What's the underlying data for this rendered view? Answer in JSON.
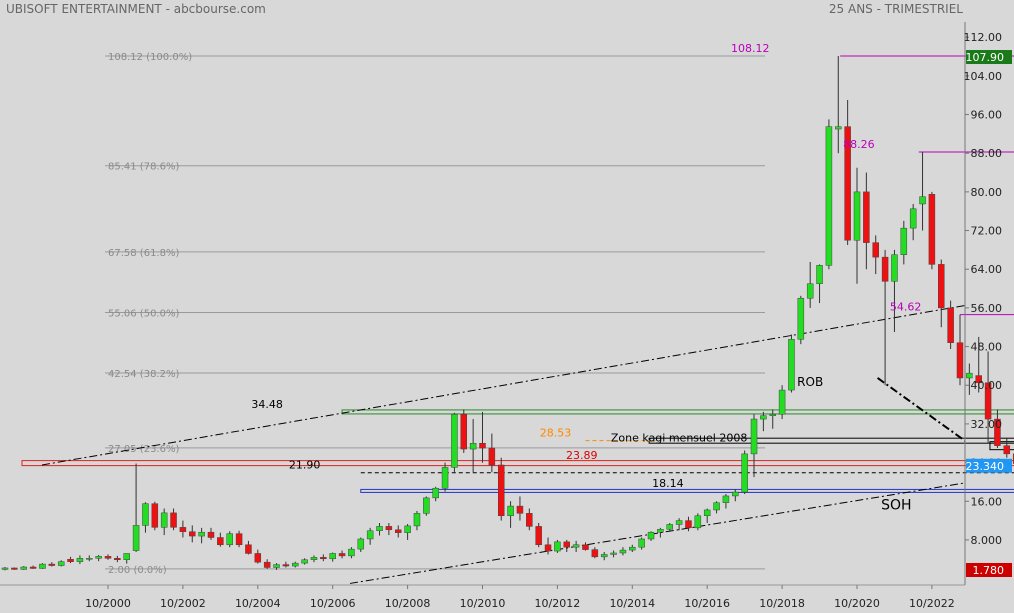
{
  "header": {
    "left_title": "UBISOFT ENTERTAINMENT - abcbourse.com",
    "right_title": "25 ANS - TRIMESTRIEL"
  },
  "colors": {
    "background": "#d8d8d8",
    "up": "#22dd22",
    "down": "#ee1111",
    "price_badge": "#2196f3",
    "last_price_badge": "#cc0000",
    "high_badge": "#1a7a1a",
    "magenta": "#bb00bb",
    "fib_text": "#8a8a8a"
  },
  "chart_data": {
    "type": "candlestick",
    "title": "UBISOFT ENTERTAINMENT - abcbourse.com",
    "subtitle": "25 ANS - TRIMESTRIEL",
    "ylim": [
      0,
      116
    ],
    "y_ticks": [
      "112.00",
      "104.00",
      "96.00",
      "88.00",
      "80.00",
      "72.00",
      "64.00",
      "56.00",
      "48.00",
      "40.00",
      "32.00",
      "24.00",
      "16.00",
      "8.000"
    ],
    "y_tick_values": [
      112,
      104,
      96,
      88,
      80,
      72,
      64,
      56,
      48,
      40,
      32,
      24,
      16,
      8
    ],
    "x_ticks": [
      "10/2000",
      "10/2002",
      "10/2004",
      "10/2006",
      "10/2008",
      "10/2010",
      "10/2012",
      "10/2014",
      "10/2016",
      "10/2018",
      "10/2020",
      "10/2022"
    ],
    "x_tick_years": [
      2000.75,
      2002.75,
      2004.75,
      2006.75,
      2008.75,
      2010.75,
      2012.75,
      2014.75,
      2016.75,
      2018.75,
      2020.75,
      2022.75
    ],
    "price_badges": [
      {
        "label": "107.90",
        "value": 107.9,
        "role": "high"
      },
      {
        "label": "23.340",
        "value": 23.34,
        "role": "current"
      },
      {
        "label": "1.780",
        "value": 1.78,
        "role": "low"
      }
    ],
    "fib_levels": [
      {
        "label": "108.12  (100.0%)",
        "value": 108.12
      },
      {
        "label": "85.41  (78.6%)",
        "value": 85.41
      },
      {
        "label": "67.58  (61.8%)",
        "value": 67.58
      },
      {
        "label": "55.06  (50.0%)",
        "value": 55.06
      },
      {
        "label": "42.54  (38.2%)",
        "value": 42.54
      },
      {
        "label": "27.05  (23.6%)",
        "value": 27.05
      },
      {
        "label": "2.00  (0.0%)",
        "value": 2.0
      }
    ],
    "annotations": [
      {
        "label": "108.12",
        "x": 2017.9,
        "y": 108.12,
        "color": "#bb00bb"
      },
      {
        "label": "88.26",
        "x": 2020.8,
        "y": 88.26,
        "color": "#bb00bb"
      },
      {
        "label": "54.62",
        "x": 2022.05,
        "y": 54.62,
        "color": "#bb00bb"
      },
      {
        "label": "34.48",
        "x": 2005.0,
        "y": 34.48,
        "color": "#000000"
      },
      {
        "label": "28.53",
        "x": 2012.7,
        "y": 28.53,
        "color": "#ff8800"
      },
      {
        "label": "23.89",
        "x": 2013.4,
        "y": 23.89,
        "color": "#dd0000"
      },
      {
        "label": "21.90",
        "x": 2006.0,
        "y": 21.9,
        "color": "#000000"
      },
      {
        "label": "18.14",
        "x": 2015.7,
        "y": 18.14,
        "color": "#000000"
      },
      {
        "label": "Zone kagi mensuel 2008",
        "x": 2016.0,
        "y": 27.5,
        "color": "#000000"
      },
      {
        "label": "ROB",
        "x": 2019.5,
        "y": 39.0,
        "color": "#000000"
      },
      {
        "label": "SOH",
        "x": 2021.8,
        "y": 13.5,
        "color": "#000000"
      }
    ],
    "candles": [
      {
        "x": 1997.75,
        "o": 1.8,
        "h": 2.0,
        "l": 1.4,
        "c": 1.9
      },
      {
        "x": 1998.0,
        "o": 1.9,
        "h": 2.4,
        "l": 1.7,
        "c": 2.2
      },
      {
        "x": 1998.25,
        "o": 2.2,
        "h": 2.3,
        "l": 1.8,
        "c": 1.9
      },
      {
        "x": 1998.5,
        "o": 1.9,
        "h": 2.6,
        "l": 1.8,
        "c": 2.4
      },
      {
        "x": 1998.75,
        "o": 2.4,
        "h": 2.7,
        "l": 2.0,
        "c": 2.1
      },
      {
        "x": 1999.0,
        "o": 2.1,
        "h": 3.2,
        "l": 2.0,
        "c": 3.0
      },
      {
        "x": 1999.25,
        "o": 3.0,
        "h": 3.4,
        "l": 2.5,
        "c": 2.7
      },
      {
        "x": 1999.5,
        "o": 2.7,
        "h": 3.8,
        "l": 2.5,
        "c": 3.5
      },
      {
        "x": 1999.75,
        "o": 4.0,
        "h": 4.5,
        "l": 3.2,
        "c": 3.5
      },
      {
        "x": 2000.0,
        "o": 3.5,
        "h": 4.8,
        "l": 3.0,
        "c": 4.2
      },
      {
        "x": 2000.25,
        "o": 4.2,
        "h": 4.8,
        "l": 3.6,
        "c": 4.2
      },
      {
        "x": 2000.5,
        "o": 4.2,
        "h": 4.9,
        "l": 3.6,
        "c": 4.6
      },
      {
        "x": 2000.75,
        "o": 4.6,
        "h": 5.0,
        "l": 3.9,
        "c": 4.2
      },
      {
        "x": 2001.0,
        "o": 4.2,
        "h": 4.7,
        "l": 3.4,
        "c": 3.9
      },
      {
        "x": 2001.25,
        "o": 3.9,
        "h": 5.2,
        "l": 3.1,
        "c": 5.2
      },
      {
        "x": 2001.5,
        "o": 5.8,
        "h": 23.8,
        "l": 5.5,
        "c": 11.0
      },
      {
        "x": 2001.75,
        "o": 11.0,
        "h": 15.8,
        "l": 9.5,
        "c": 15.5
      },
      {
        "x": 2002.0,
        "o": 15.5,
        "h": 15.9,
        "l": 10.0,
        "c": 10.6
      },
      {
        "x": 2002.25,
        "o": 10.6,
        "h": 14.5,
        "l": 9.0,
        "c": 13.6
      },
      {
        "x": 2002.5,
        "o": 13.6,
        "h": 14.5,
        "l": 10.0,
        "c": 10.6
      },
      {
        "x": 2002.75,
        "o": 10.6,
        "h": 12.0,
        "l": 8.5,
        "c": 9.7
      },
      {
        "x": 2003.0,
        "o": 9.7,
        "h": 11.0,
        "l": 7.5,
        "c": 8.8
      },
      {
        "x": 2003.25,
        "o": 8.8,
        "h": 10.5,
        "l": 7.3,
        "c": 9.6
      },
      {
        "x": 2003.5,
        "o": 9.6,
        "h": 10.5,
        "l": 8.0,
        "c": 8.5
      },
      {
        "x": 2003.75,
        "o": 8.5,
        "h": 9.5,
        "l": 6.6,
        "c": 7.0
      },
      {
        "x": 2004.0,
        "o": 7.0,
        "h": 9.8,
        "l": 6.5,
        "c": 9.3
      },
      {
        "x": 2004.25,
        "o": 9.3,
        "h": 9.9,
        "l": 6.5,
        "c": 7.0
      },
      {
        "x": 2004.5,
        "o": 7.0,
        "h": 7.8,
        "l": 5.0,
        "c": 5.2
      },
      {
        "x": 2004.75,
        "o": 5.2,
        "h": 6.0,
        "l": 3.1,
        "c": 3.4
      },
      {
        "x": 2005.0,
        "o": 3.4,
        "h": 4.0,
        "l": 2.0,
        "c": 2.3
      },
      {
        "x": 2005.25,
        "o": 2.3,
        "h": 3.2,
        "l": 1.8,
        "c": 2.9
      },
      {
        "x": 2005.5,
        "o": 2.9,
        "h": 3.5,
        "l": 2.3,
        "c": 2.6
      },
      {
        "x": 2005.75,
        "o": 2.6,
        "h": 3.5,
        "l": 2.3,
        "c": 3.2
      },
      {
        "x": 2006.0,
        "o": 3.2,
        "h": 4.2,
        "l": 2.9,
        "c": 3.9
      },
      {
        "x": 2006.25,
        "o": 3.9,
        "h": 4.8,
        "l": 3.4,
        "c": 4.4
      },
      {
        "x": 2006.5,
        "o": 4.4,
        "h": 5.0,
        "l": 3.6,
        "c": 4.1
      },
      {
        "x": 2006.75,
        "o": 4.1,
        "h": 5.4,
        "l": 3.5,
        "c": 5.2
      },
      {
        "x": 2007.0,
        "o": 5.2,
        "h": 5.8,
        "l": 4.2,
        "c": 4.7
      },
      {
        "x": 2007.25,
        "o": 4.7,
        "h": 6.5,
        "l": 4.2,
        "c": 6.1
      },
      {
        "x": 2007.5,
        "o": 6.1,
        "h": 8.5,
        "l": 5.5,
        "c": 8.2
      },
      {
        "x": 2007.75,
        "o": 8.2,
        "h": 10.5,
        "l": 7.0,
        "c": 9.9
      },
      {
        "x": 2008.0,
        "o": 9.9,
        "h": 11.5,
        "l": 8.9,
        "c": 10.8
      },
      {
        "x": 2008.25,
        "o": 10.8,
        "h": 11.5,
        "l": 9.0,
        "c": 10.1
      },
      {
        "x": 2008.5,
        "o": 10.1,
        "h": 11.0,
        "l": 8.5,
        "c": 9.5
      },
      {
        "x": 2008.75,
        "o": 9.5,
        "h": 11.3,
        "l": 8.0,
        "c": 10.9
      },
      {
        "x": 2009.0,
        "o": 10.9,
        "h": 14.0,
        "l": 10.0,
        "c": 13.5
      },
      {
        "x": 2009.25,
        "o": 13.5,
        "h": 17.0,
        "l": 13.0,
        "c": 16.7
      },
      {
        "x": 2009.5,
        "o": 16.7,
        "h": 19.0,
        "l": 16.0,
        "c": 18.7
      },
      {
        "x": 2009.75,
        "o": 18.7,
        "h": 24.0,
        "l": 18.0,
        "c": 23.0
      },
      {
        "x": 2010.0,
        "o": 23.0,
        "h": 34.3,
        "l": 22.0,
        "c": 34.0
      },
      {
        "x": 2010.25,
        "o": 34.0,
        "h": 35.0,
        "l": 26.0,
        "c": 26.8
      },
      {
        "x": 2010.5,
        "o": 26.8,
        "h": 33.0,
        "l": 22.0,
        "c": 28.0
      },
      {
        "x": 2010.75,
        "o": 28.0,
        "h": 34.5,
        "l": 24.0,
        "c": 27.0
      },
      {
        "x": 2011.0,
        "o": 27.0,
        "h": 30.0,
        "l": 22.0,
        "c": 23.5
      },
      {
        "x": 2011.25,
        "o": 23.5,
        "h": 25.0,
        "l": 12.0,
        "c": 13.0
      },
      {
        "x": 2011.5,
        "o": 13.0,
        "h": 16.0,
        "l": 10.5,
        "c": 15.0
      },
      {
        "x": 2011.75,
        "o": 15.0,
        "h": 17.0,
        "l": 12.0,
        "c": 13.5
      },
      {
        "x": 2012.0,
        "o": 13.5,
        "h": 14.5,
        "l": 10.0,
        "c": 10.8
      },
      {
        "x": 2012.25,
        "o": 10.8,
        "h": 11.5,
        "l": 6.5,
        "c": 7.0
      },
      {
        "x": 2012.5,
        "o": 7.0,
        "h": 8.5,
        "l": 5.0,
        "c": 5.7
      },
      {
        "x": 2012.75,
        "o": 5.7,
        "h": 8.0,
        "l": 5.3,
        "c": 7.6
      },
      {
        "x": 2013.0,
        "o": 7.6,
        "h": 8.0,
        "l": 5.5,
        "c": 6.5
      },
      {
        "x": 2013.25,
        "o": 6.5,
        "h": 7.8,
        "l": 5.5,
        "c": 7.0
      },
      {
        "x": 2013.5,
        "o": 7.0,
        "h": 7.5,
        "l": 5.8,
        "c": 6.0
      },
      {
        "x": 2013.75,
        "o": 6.0,
        "h": 6.5,
        "l": 4.2,
        "c": 4.5
      },
      {
        "x": 2014.0,
        "o": 4.5,
        "h": 5.5,
        "l": 3.8,
        "c": 5.0
      },
      {
        "x": 2014.25,
        "o": 5.0,
        "h": 5.8,
        "l": 4.4,
        "c": 5.3
      },
      {
        "x": 2014.5,
        "o": 5.3,
        "h": 6.5,
        "l": 4.8,
        "c": 5.9
      },
      {
        "x": 2014.75,
        "o": 5.9,
        "h": 7.0,
        "l": 5.5,
        "c": 6.5
      },
      {
        "x": 2015.0,
        "o": 6.5,
        "h": 8.5,
        "l": 6.0,
        "c": 8.2
      },
      {
        "x": 2015.25,
        "o": 8.2,
        "h": 9.8,
        "l": 7.8,
        "c": 9.6
      },
      {
        "x": 2015.5,
        "o": 9.6,
        "h": 10.5,
        "l": 8.5,
        "c": 10.2
      },
      {
        "x": 2015.75,
        "o": 10.2,
        "h": 11.5,
        "l": 9.8,
        "c": 11.2
      },
      {
        "x": 2016.0,
        "o": 11.2,
        "h": 12.5,
        "l": 10.0,
        "c": 12.0
      },
      {
        "x": 2016.25,
        "o": 12.0,
        "h": 12.8,
        "l": 9.8,
        "c": 10.5
      },
      {
        "x": 2016.5,
        "o": 10.5,
        "h": 13.5,
        "l": 10.0,
        "c": 13.0
      },
      {
        "x": 2016.75,
        "o": 13.0,
        "h": 14.5,
        "l": 11.5,
        "c": 14.2
      },
      {
        "x": 2017.0,
        "o": 14.2,
        "h": 16.0,
        "l": 13.5,
        "c": 15.7
      },
      {
        "x": 2017.25,
        "o": 15.7,
        "h": 17.5,
        "l": 14.5,
        "c": 17.1
      },
      {
        "x": 2017.5,
        "o": 17.1,
        "h": 18.5,
        "l": 16.0,
        "c": 17.9
      },
      {
        "x": 2017.75,
        "o": 17.9,
        "h": 26.5,
        "l": 17.5,
        "c": 25.8
      },
      {
        "x": 2018.0,
        "o": 25.8,
        "h": 34.0,
        "l": 21.0,
        "c": 33.0
      },
      {
        "x": 2018.25,
        "o": 33.0,
        "h": 34.5,
        "l": 30.5,
        "c": 33.7
      },
      {
        "x": 2018.5,
        "o": 33.7,
        "h": 35.0,
        "l": 31.0,
        "c": 34.0
      },
      {
        "x": 2018.75,
        "o": 34.0,
        "h": 40.0,
        "l": 33.0,
        "c": 39.0
      },
      {
        "x": 2019.0,
        "o": 39.0,
        "h": 50.5,
        "l": 38.5,
        "c": 49.5
      },
      {
        "x": 2019.25,
        "o": 49.5,
        "h": 58.5,
        "l": 48.5,
        "c": 58.0
      },
      {
        "x": 2019.5,
        "o": 58.0,
        "h": 65.5,
        "l": 56.0,
        "c": 61.0
      },
      {
        "x": 2019.75,
        "o": 61.0,
        "h": 65.0,
        "l": 57.0,
        "c": 64.8
      },
      {
        "x": 2020.0,
        "o": 64.8,
        "h": 95.0,
        "l": 64.0,
        "c": 93.5
      },
      {
        "x": 2020.25,
        "o": 93.0,
        "h": 108.12,
        "l": 88.0,
        "c": 93.5
      },
      {
        "x": 2020.5,
        "o": 93.5,
        "h": 99.0,
        "l": 69.0,
        "c": 70.0
      },
      {
        "x": 2020.75,
        "o": 70.0,
        "h": 85.0,
        "l": 61.0,
        "c": 80.0
      },
      {
        "x": 2021.0,
        "o": 80.0,
        "h": 84.0,
        "l": 64.0,
        "c": 69.5
      },
      {
        "x": 2021.25,
        "o": 69.5,
        "h": 71.0,
        "l": 63.0,
        "c": 66.5
      },
      {
        "x": 2021.5,
        "o": 66.5,
        "h": 68.0,
        "l": 40.0,
        "c": 61.5
      },
      {
        "x": 2021.75,
        "o": 61.5,
        "h": 68.0,
        "l": 51.0,
        "c": 67.0
      },
      {
        "x": 2022.0,
        "o": 67.0,
        "h": 74.0,
        "l": 65.0,
        "c": 72.5
      },
      {
        "x": 2022.25,
        "o": 72.5,
        "h": 77.5,
        "l": 70.0,
        "c": 76.5
      },
      {
        "x": 2022.5,
        "o": 77.5,
        "h": 88.26,
        "l": 72.0,
        "c": 79.0
      },
      {
        "x": 2022.75,
        "o": 79.5,
        "h": 80.0,
        "l": 64.0,
        "c": 65.0
      },
      {
        "x": 2023.0,
        "o": 65.0,
        "h": 66.0,
        "l": 52.0,
        "c": 56.0
      },
      {
        "x": 2023.25,
        "o": 56.0,
        "h": 57.5,
        "l": 47.5,
        "c": 48.8
      },
      {
        "x": 2023.5,
        "o": 48.8,
        "h": 54.62,
        "l": 40.0,
        "c": 41.5
      },
      {
        "x": 2023.75,
        "o": 41.5,
        "h": 44.5,
        "l": 38.0,
        "c": 42.5
      },
      {
        "x": 2024.0,
        "o": 42.0,
        "h": 50.0,
        "l": 38.5,
        "c": 40.5
      },
      {
        "x": 2024.25,
        "o": 40.5,
        "h": 47.0,
        "l": 28.0,
        "c": 33.0
      },
      {
        "x": 2024.5,
        "o": 33.0,
        "h": 35.0,
        "l": 27.0,
        "c": 27.5
      },
      {
        "x": 2024.75,
        "o": 27.5,
        "h": 29.0,
        "l": 25.0,
        "c": 25.8
      },
      {
        "x": 2025.0,
        "o": 25.8,
        "h": 27.5,
        "l": 17.5,
        "c": 23.8
      },
      {
        "x": 2025.25,
        "o": 23.8,
        "h": 26.0,
        "l": 21.5,
        "c": 22.8
      },
      {
        "x": 2025.5,
        "o": 22.8,
        "h": 26.5,
        "l": 22.0,
        "c": 24.5
      },
      {
        "x": 2025.75,
        "o": 24.0,
        "h": 29.3,
        "l": 23.5,
        "c": 28.8
      },
      {
        "x": 2026.0,
        "o": 28.8,
        "h": 29.3,
        "l": 22.5,
        "c": 23.34
      }
    ]
  }
}
